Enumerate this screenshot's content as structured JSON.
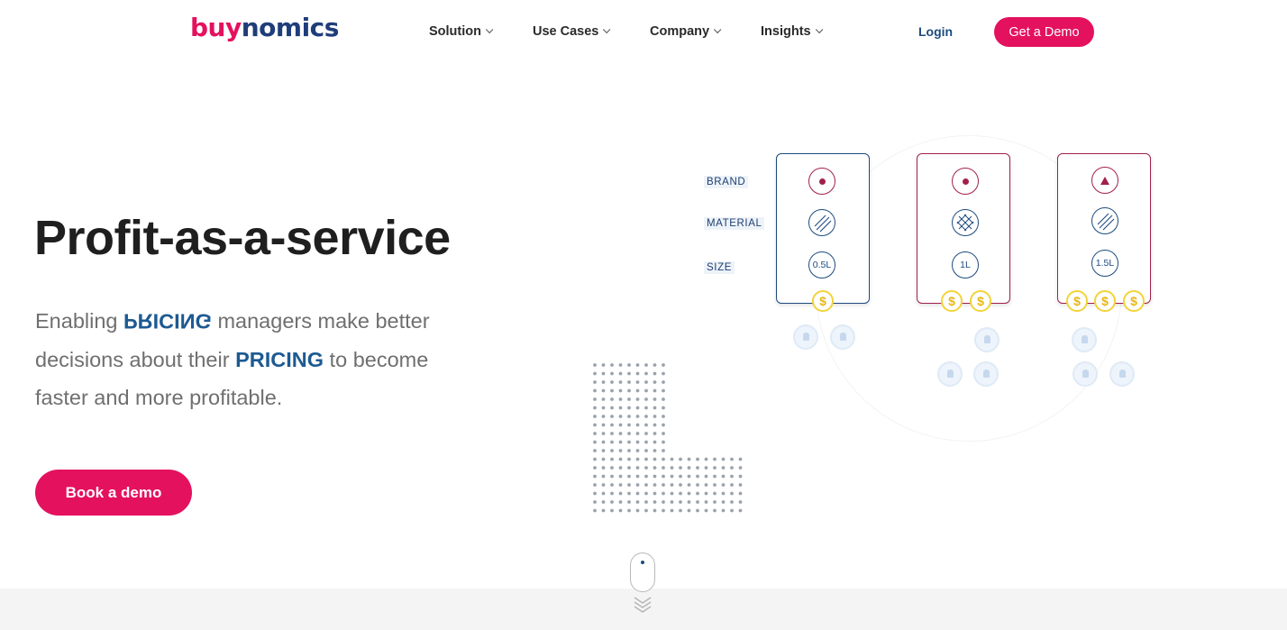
{
  "header": {
    "logo_part1": "buy",
    "logo_part2": "nomics",
    "nav": [
      {
        "label": "Solution"
      },
      {
        "label": "Use Cases"
      },
      {
        "label": "Company"
      },
      {
        "label": "Insights"
      }
    ],
    "login_label": "Login",
    "cta_label": "Get a Demo"
  },
  "hero": {
    "headline": "Profit-as-a-service",
    "sub_prefix": "Enabling ",
    "sub_flipped": "PRICING",
    "sub_mid": " managers make better decisions about their ",
    "sub_keyword": "PRICING",
    "sub_suffix": " to become faster and more profitable.",
    "cta_label": "Book a demo"
  },
  "illustration": {
    "attributes": [
      "BRAND",
      "MATERIAL",
      "SIZE"
    ],
    "cards": [
      {
        "size": "0.5L",
        "coins": 1,
        "brand_icon": "dot-icon",
        "material_icon": "stripes-icon"
      },
      {
        "size": "1L",
        "coins": 2,
        "brand_icon": "dot-icon",
        "material_icon": "crosshatch-icon"
      },
      {
        "size": "1.5L",
        "coins": 3,
        "brand_icon": "triangle-icon",
        "material_icon": "stripes-icon"
      }
    ],
    "coin_symbol": "$"
  },
  "colors": {
    "brand_pink": "#e4115f",
    "brand_navy": "#1f3d7a",
    "accent_blue": "#1d5a92",
    "card_pink": "#a11f4d",
    "coin_yellow": "#f2d33a"
  }
}
